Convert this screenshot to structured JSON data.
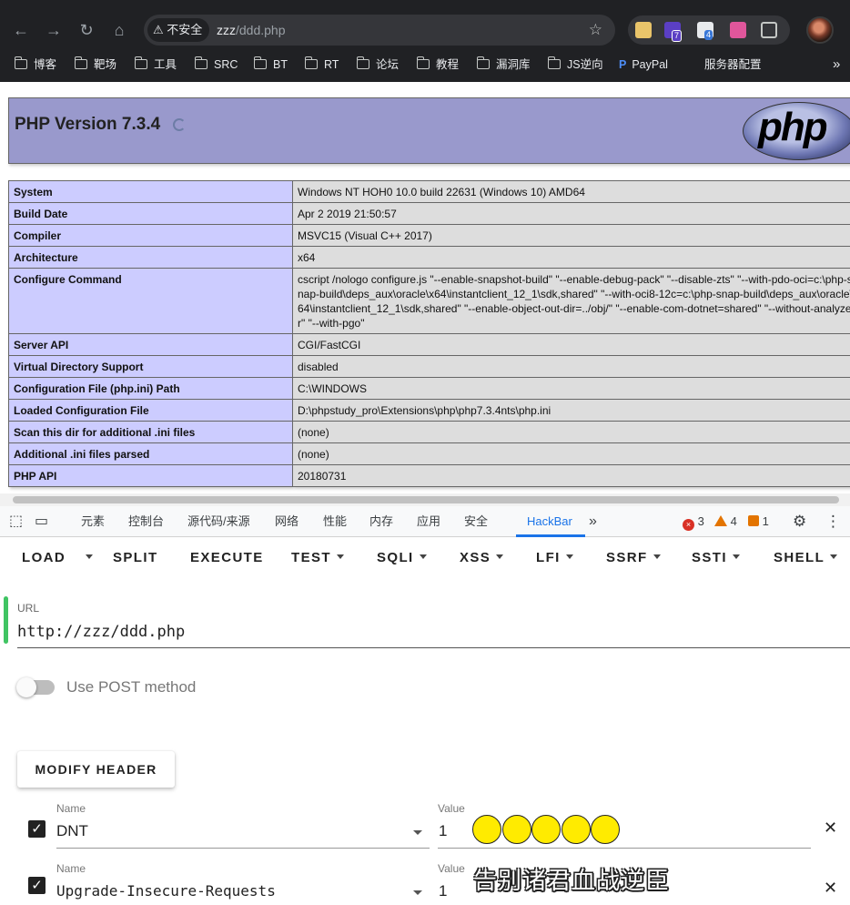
{
  "browser": {
    "security_label": "不安全",
    "url_host": "zzz",
    "url_path": "/ddd.php",
    "ext_badges": [
      "7",
      "4"
    ],
    "bookmarks": [
      "博客",
      "靶场",
      "工具",
      "SRC",
      "BT",
      "RT",
      "论坛",
      "教程",
      "漏洞库",
      "JS逆向",
      "PayPal",
      "服务器配置"
    ],
    "overflow": "»"
  },
  "phpinfo": {
    "title": "PHP Version 7.3.4",
    "logo": "php",
    "rows": [
      {
        "key": "System",
        "value": "Windows NT HOH0 10.0 build 22631 (Windows 10) AMD64"
      },
      {
        "key": "Build Date",
        "value": "Apr 2 2019 21:50:57"
      },
      {
        "key": "Compiler",
        "value": "MSVC15 (Visual C++ 2017)"
      },
      {
        "key": "Architecture",
        "value": "x64"
      },
      {
        "key": "Configure Command",
        "value": "cscript /nologo configure.js \"--enable-snapshot-build\" \"--enable-debug-pack\" \"--disable-zts\" \"--with-pdo-oci=c:\\php-snap-build\\deps_aux\\oracle\\x64\\instantclient_12_1\\sdk,shared\" \"--with-oci8-12c=c:\\php-snap-build\\deps_aux\\oracle\\x64\\instantclient_12_1\\sdk,shared\" \"--enable-object-out-dir=../obj/\" \"--enable-com-dotnet=shared\" \"--without-analyzer\" \"--with-pgo\""
      },
      {
        "key": "Server API",
        "value": "CGI/FastCGI"
      },
      {
        "key": "Virtual Directory Support",
        "value": "disabled"
      },
      {
        "key": "Configuration File (php.ini) Path",
        "value": "C:\\WINDOWS"
      },
      {
        "key": "Loaded Configuration File",
        "value": "D:\\phpstudy_pro\\Extensions\\php\\php7.3.4nts\\php.ini"
      },
      {
        "key": "Scan this dir for additional .ini files",
        "value": "(none)"
      },
      {
        "key": "Additional .ini files parsed",
        "value": "(none)"
      },
      {
        "key": "PHP API",
        "value": "20180731"
      }
    ]
  },
  "devtools": {
    "tabs": [
      "元素",
      "控制台",
      "源代码/来源",
      "网络",
      "性能",
      "内存",
      "应用",
      "安全",
      "HackBar"
    ],
    "more": "»",
    "errors": "3",
    "warnings": "4",
    "issues": "1"
  },
  "hackbar": {
    "menu": [
      "LOAD",
      "SPLIT",
      "EXECUTE",
      "TEST",
      "SQLI",
      "XSS",
      "LFI",
      "SSRF",
      "SSTI",
      "SHELL"
    ],
    "url_label": "URL",
    "url_value": "http://zzz/ddd.php",
    "post_label": "Use POST method",
    "modify_header": "MODIFY HEADER",
    "headers": [
      {
        "name_label": "Name",
        "name": "DNT",
        "value_label": "Value",
        "value": "1",
        "checked": true
      },
      {
        "name_label": "Name",
        "name": "Upgrade-Insecure-Requests",
        "value_label": "Value",
        "value": "1",
        "checked": true
      }
    ]
  },
  "overlay_caption": "告别诸君血战逆臣",
  "overlay_dots": 5
}
